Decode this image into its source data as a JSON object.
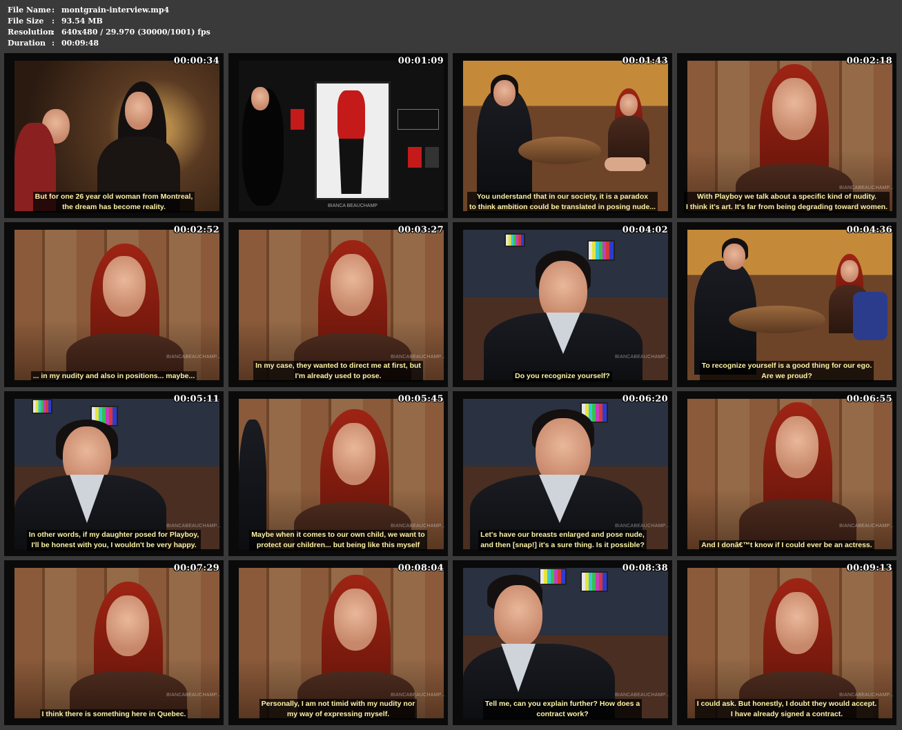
{
  "info": {
    "file_name_label": "File Name",
    "file_name": "montgrain-interview.mp4",
    "file_size_label": "File Size",
    "file_size": "93.54 MB",
    "resolution_label": "Resolution",
    "resolution": "640x480 / 29.970 (30000/1001) fps",
    "duration_label": "Duration",
    "duration": "00:09:48",
    "separator": ":"
  },
  "watermark": "BIANCABEAUCHAMP...",
  "thumbnails": [
    {
      "time": "00:00:34",
      "subtitle": "But for one 26 year old woman from Montreal,\nthe dream has become reality."
    },
    {
      "time": "00:01:09",
      "subtitle": "",
      "poster_caption": "BIANCA BEAUCHAMP"
    },
    {
      "time": "00:01:43",
      "subtitle": "You understand that in our society, it is a paradox\nto think ambition could be translated in posing nude..."
    },
    {
      "time": "00:02:18",
      "subtitle": "With Playboy we talk about a specific kind of nudity.\nI think it's art.  It's far from being degrading toward women."
    },
    {
      "time": "00:02:52",
      "subtitle": "... in my nudity and also in positions... maybe..."
    },
    {
      "time": "00:03:27",
      "subtitle": "In my case, they wanted to direct me at first, but\nI'm already used to pose."
    },
    {
      "time": "00:04:02",
      "subtitle": "Do you recognize yourself?"
    },
    {
      "time": "00:04:36",
      "subtitle": "To recognize yourself is a good thing for our ego.\nAre we proud?"
    },
    {
      "time": "00:05:11",
      "subtitle": "In other words, if my daughter posed for Playboy,\nI'll be honest with you, I wouldn't be very happy."
    },
    {
      "time": "00:05:45",
      "subtitle": "Maybe when it comes to our own child, we want to\nprotect our children...  but being like this myself"
    },
    {
      "time": "00:06:20",
      "subtitle": "Let's have our breasts enlarged and pose nude,\nand then [snap!] it's a sure thing.  Is it possible?"
    },
    {
      "time": "00:06:55",
      "subtitle": "And I donâ€™t know if I could ever be an actress."
    },
    {
      "time": "00:07:29",
      "subtitle": "I think there is something here in Quebec."
    },
    {
      "time": "00:08:04",
      "subtitle": "Personally, I am not timid with my nudity nor\nmy way of expressing myself."
    },
    {
      "time": "00:08:38",
      "subtitle": "Tell me, can you explain further? How does a\ncontract work?"
    },
    {
      "time": "00:09:13",
      "subtitle": "I could ask. But honestly, I doubt they would accept.\nI have already signed a contract."
    }
  ]
}
